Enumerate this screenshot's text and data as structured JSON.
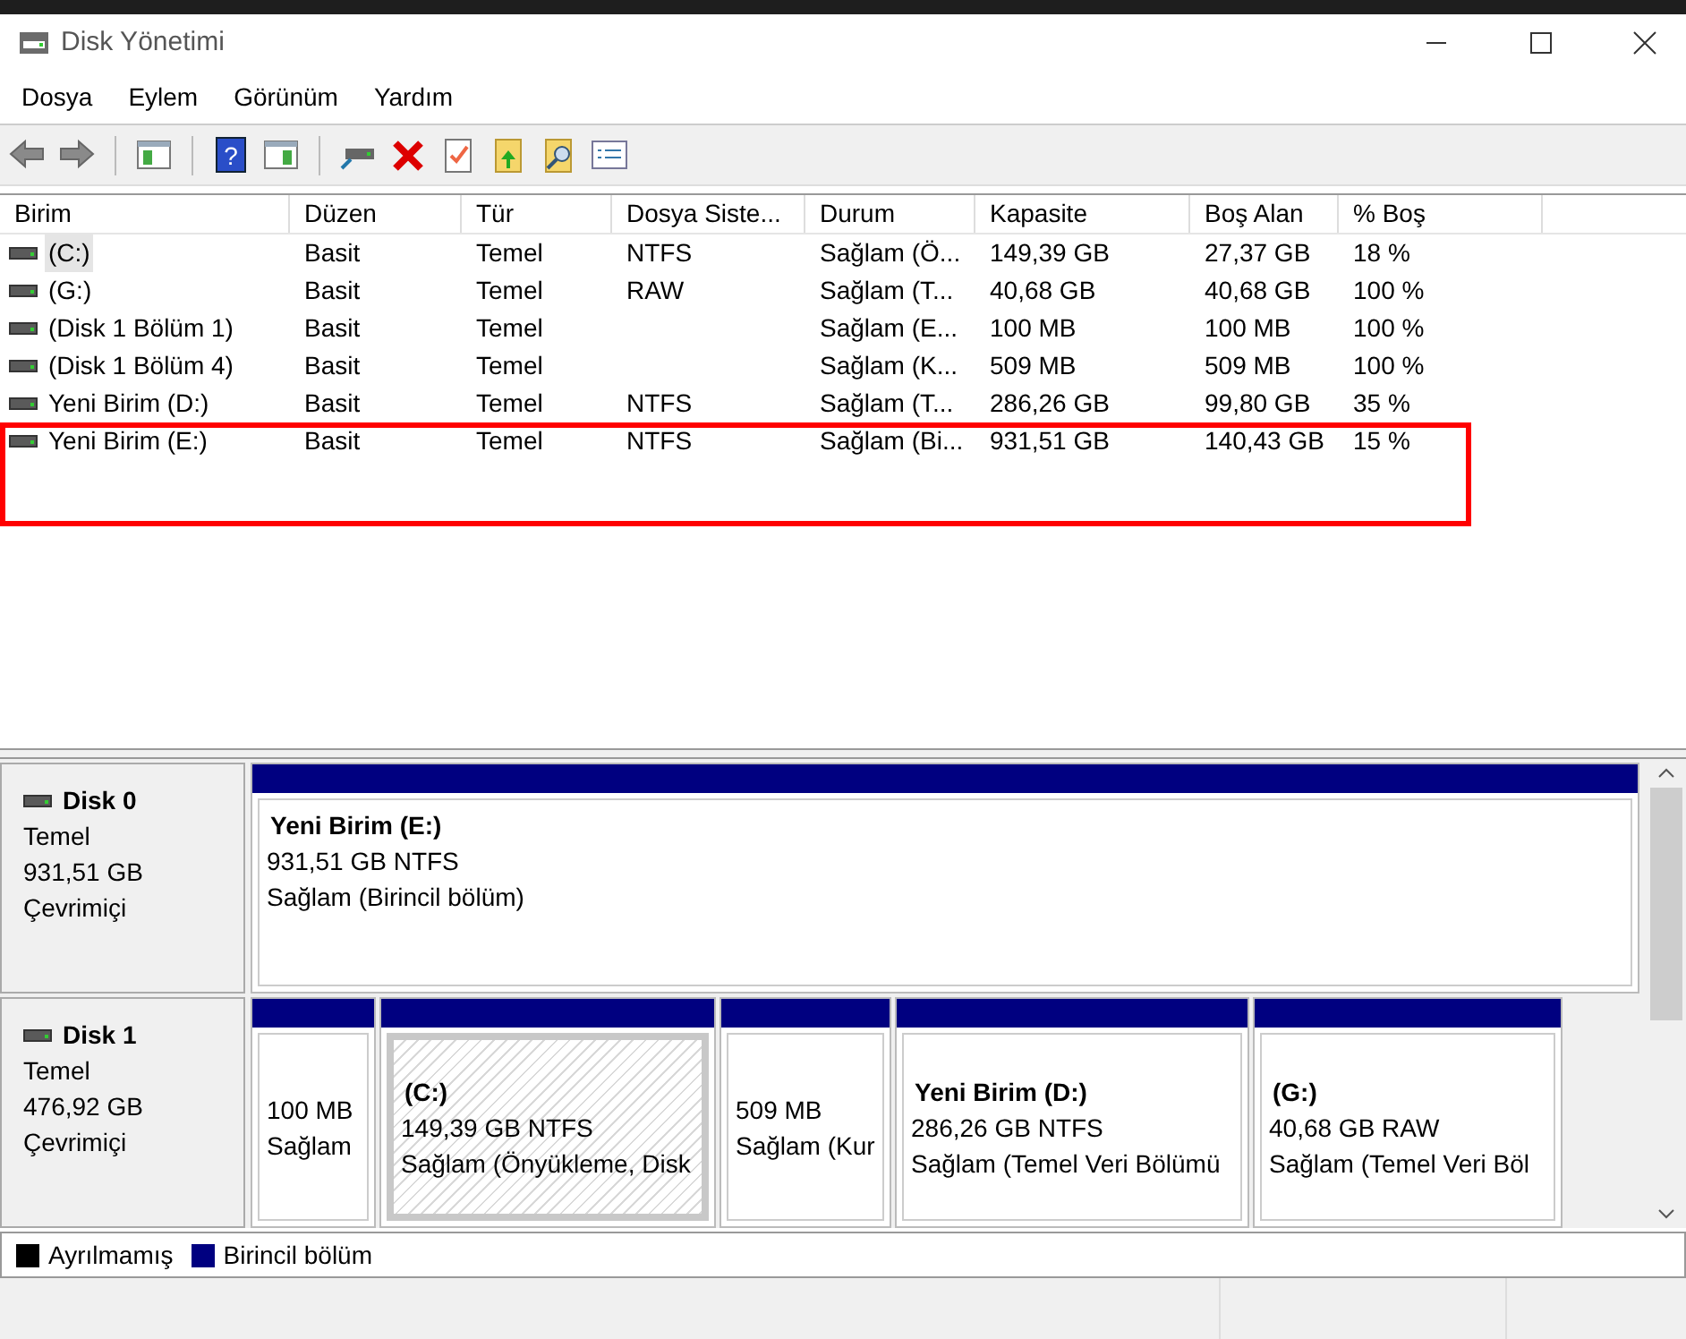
{
  "window": {
    "title": "Disk Yönetimi"
  },
  "menu": [
    "Dosya",
    "Eylem",
    "Görünüm",
    "Yardım"
  ],
  "toolbar": {
    "help_glyph": "?"
  },
  "table": {
    "columns": [
      "Birim",
      "Düzen",
      "Tür",
      "Dosya Siste...",
      "Durum",
      "Kapasite",
      "Boş Alan",
      "% Boş"
    ],
    "rows": [
      {
        "selected": true,
        "cells": [
          "(C:)",
          "Basit",
          "Temel",
          "NTFS",
          "Sağlam (Ö...",
          "149,39 GB",
          "27,37 GB",
          "18 %"
        ]
      },
      {
        "selected": false,
        "cells": [
          "(G:)",
          "Basit",
          "Temel",
          "RAW",
          "Sağlam (T...",
          "40,68 GB",
          "40,68 GB",
          "100 %"
        ]
      },
      {
        "selected": false,
        "cells": [
          "(Disk 1 Bölüm 1)",
          "Basit",
          "Temel",
          "",
          "Sağlam (E...",
          "100 MB",
          "100 MB",
          "100 %"
        ]
      },
      {
        "selected": false,
        "cells": [
          "(Disk 1 Bölüm 4)",
          "Basit",
          "Temel",
          "",
          "Sağlam (K...",
          "509 MB",
          "509 MB",
          "100 %"
        ]
      },
      {
        "selected": false,
        "cells": [
          "Yeni Birim (D:)",
          "Basit",
          "Temel",
          "NTFS",
          "Sağlam (T...",
          "286,26 GB",
          "99,80 GB",
          "35 %"
        ]
      },
      {
        "selected": false,
        "cells": [
          "Yeni Birim (E:)",
          "Basit",
          "Temel",
          "NTFS",
          "Sağlam (Bi...",
          "931,51 GB",
          "140,43 GB",
          "15 %"
        ]
      }
    ]
  },
  "disks": [
    {
      "name": "Disk 0",
      "type": "Temel",
      "size": "931,51 GB",
      "status": "Çevrimiçi",
      "partitions": [
        {
          "selected": false,
          "label": "Yeni Birim  (E:)",
          "size": "931,51 GB NTFS",
          "status": "Sağlam (Birincil bölüm)"
        }
      ]
    },
    {
      "name": "Disk 1",
      "type": "Temel",
      "size": "476,92 GB",
      "status": "Çevrimiçi",
      "partitions": [
        {
          "selected": false,
          "size": "100 MB",
          "status": "Sağlam"
        },
        {
          "selected": true,
          "label": "(C:)",
          "size": "149,39 GB NTFS",
          "status": "Sağlam (Önyükleme, Disk"
        },
        {
          "selected": false,
          "size": "509 MB",
          "status": "Sağlam (Kur"
        },
        {
          "selected": false,
          "label": "Yeni Birim  (D:)",
          "size": "286,26 GB NTFS",
          "status": "Sağlam (Temel Veri Bölümü"
        },
        {
          "selected": false,
          "label": "(G:)",
          "size": "40,68 GB RAW",
          "status": "Sağlam (Temel Veri Böl"
        }
      ]
    }
  ],
  "legend": [
    {
      "label": "Ayrılmamış",
      "color": "#000000"
    },
    {
      "label": "Birincil bölüm",
      "color": "#000080"
    }
  ]
}
